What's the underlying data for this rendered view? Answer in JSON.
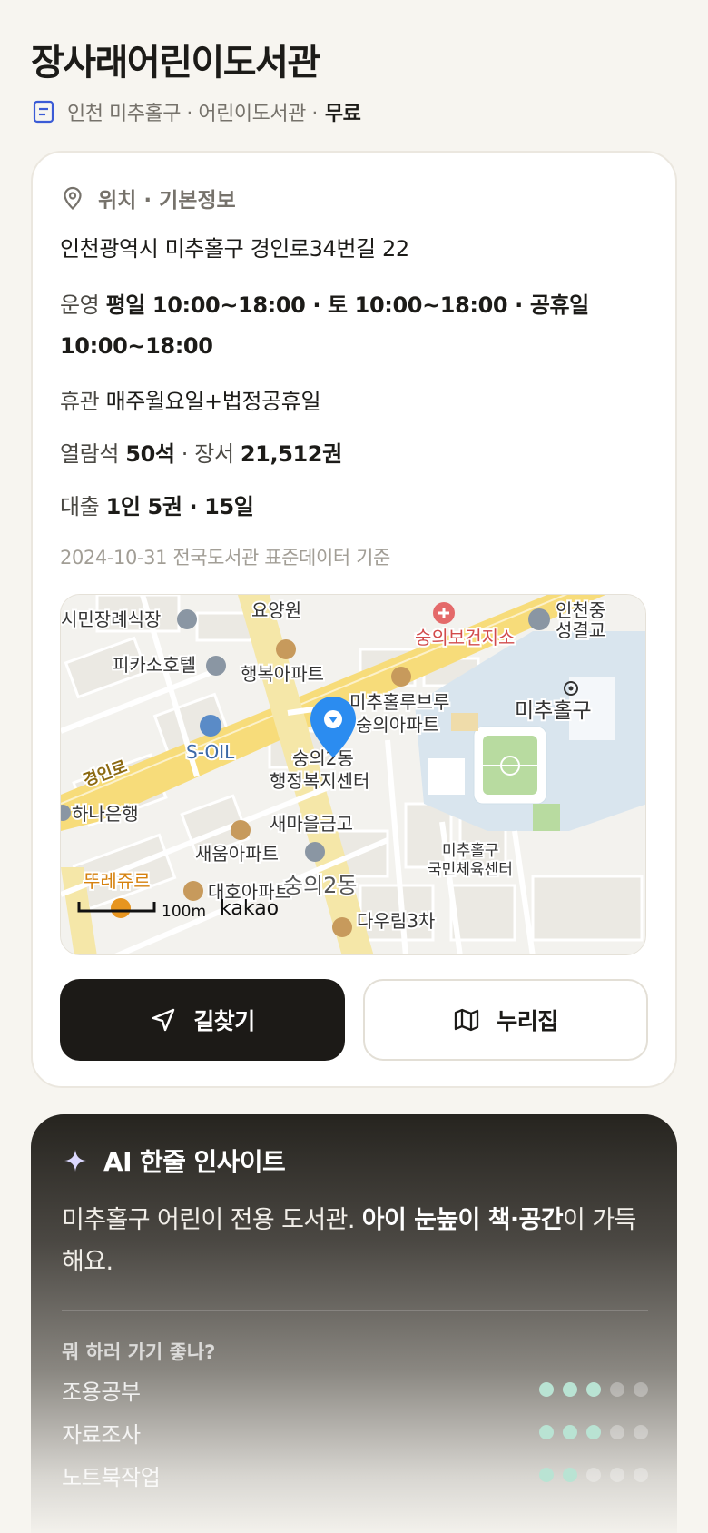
{
  "header": {
    "title": "장사래어린이도서관",
    "subtitle_text": "인천 미추홀구 · 어린이도서관 ·",
    "price": "무료"
  },
  "info": {
    "section_title": "위치 · 기본정보",
    "address": "인천광역시 미추홀구 경인로34번길 22",
    "hours_label": "운영",
    "hours_value": "평일 10:00~18:00 · 토 10:00~18:00 · 공휴일 10:00~18:00",
    "closed_label": "휴관",
    "closed_value": "매주월요일+법정공휴일",
    "seats_label": "열람석",
    "seats_value": "50석",
    "books_label": "장서",
    "books_value": "21,512권",
    "loan_label": "대출",
    "loan_value": "1인 5권 · 15일",
    "source": "2024-10-31 전국도서관 표준데이터 기준"
  },
  "map": {
    "labels": {
      "funeral": "시민장례식장",
      "yoyangwon": "요양원",
      "health_center": "숭의보건지소",
      "incheon_school": "인천중",
      "incheon_school2": "성결교",
      "hotel": "피카소호텔",
      "haengbok_apt": "행복아파트",
      "michuhol_label": "미추홀구",
      "michuhol_rubru": "미추홀루브루",
      "sungui_apt": "숭의아파트",
      "soil": "S-OIL",
      "gyeongin_road": "경인로",
      "community_center_1": "숭의2동",
      "community_center_2": "행정복지센터",
      "hana_bank": "하나은행",
      "saemaeul": "새마을금고",
      "saeum_apt": "새움아파트",
      "gym_1": "미추홀구",
      "gym_2": "국민체육센터",
      "tlejure": "뚜레쥬르",
      "daeho_apt": "대호아파트",
      "sungui2dong": "숭의2동",
      "dawoorim": "다우림3차",
      "scale": "100m",
      "brand": "kakao"
    }
  },
  "buttons": {
    "directions": "길찾기",
    "nurijip": "누리집"
  },
  "ai": {
    "title": "AI 한줄 인사이트",
    "text_plain_1": "미추홀구 어린이 전용 도서관. ",
    "text_bold": "아이 눈높이 책·공간",
    "text_plain_2": "이 가득해요.",
    "question": "뭐 하러 가기 좋나?",
    "ratings": [
      {
        "label": "조용공부",
        "score": 3,
        "max": 5
      },
      {
        "label": "자료조사",
        "score": 3,
        "max": 5
      },
      {
        "label": "노트북작업",
        "score": 2,
        "max": 5
      }
    ]
  },
  "colors": {
    "background": "#f7f5f0",
    "dark": "#1c1a17",
    "pin": "#2b8cf0",
    "road_yellow": "#f7dc7a",
    "dot_on": "#b9e3d3"
  }
}
